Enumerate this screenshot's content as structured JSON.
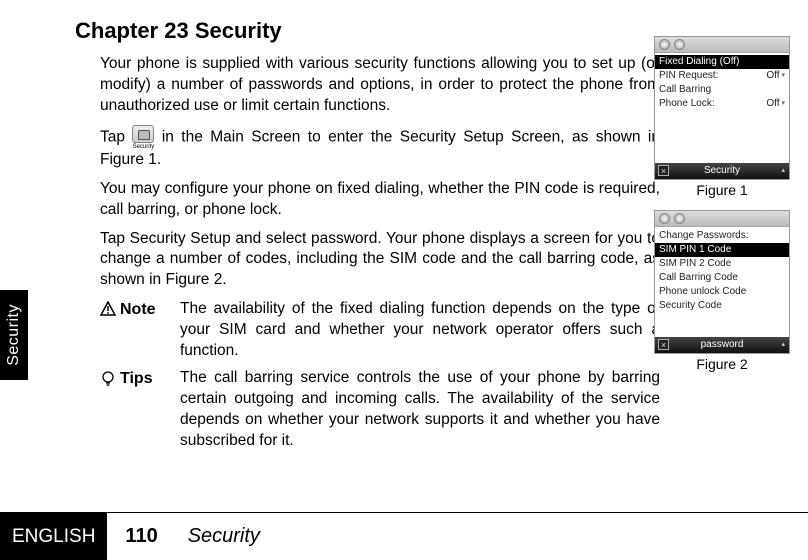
{
  "chapter_title": "Chapter 23 Security",
  "side_tab": "Security",
  "paragraphs": {
    "p1": "Your phone is supplied with various security functions allowing you to set up (or modify) a number of passwords and options, in order to protect the phone from unauthorized use or limit certain functions.",
    "p2a": "Tap ",
    "p2b": " in the Main Screen to enter the Security Setup Screen, as shown in Figure 1.",
    "p3": "You may configure your phone on fixed dialing, whether the PIN code is required, call barring, or phone lock.",
    "p4": "Tap Security Setup and select password. Your phone displays a screen for you to change a number of codes, including the SIM code and the call barring code, as shown in Figure 2."
  },
  "security_icon_label": "Security",
  "note": {
    "label": "Note",
    "body": "The availability of the fixed dialing function depends on the type of your SIM card and whether your network operator offers such a function."
  },
  "tips": {
    "label": "Tips",
    "body": "The call barring service controls the use of your phone by barring certain outgoing and incoming calls. The availability of the service depends on whether your network supports it and whether you have subscribed for it."
  },
  "figure1": {
    "caption": "Figure 1",
    "title": "Security",
    "rows": {
      "fixed_dialing": "Fixed Dialing (Off)",
      "pin_request_label": "PIN Request:",
      "pin_request_value": "Off",
      "call_barring": "Call Barring",
      "phone_lock_label": "Phone Lock:",
      "phone_lock_value": "Off"
    }
  },
  "figure2": {
    "caption": "Figure 2",
    "title": "password",
    "header": "Change Passwords:",
    "items": [
      "SIM PIN 1 Code",
      "SIM PIN 2 Code",
      "Call Barring Code",
      "Phone unlock Code",
      "Security Code"
    ]
  },
  "footer": {
    "language": "ENGLISH",
    "page_number": "110",
    "section": "Security"
  }
}
